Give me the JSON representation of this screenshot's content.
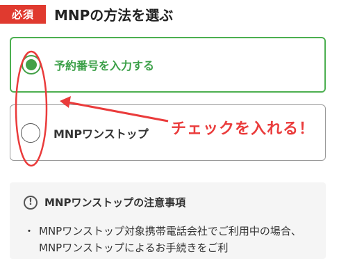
{
  "header": {
    "required_badge": "必須",
    "title": "MNPの方法を選ぶ"
  },
  "options": [
    {
      "label": "予約番号を入力する",
      "selected": true
    },
    {
      "label": "MNPワンストップ",
      "selected": false
    }
  ],
  "annotation": {
    "callout": "チェックを入れる！",
    "color": "#ea3b3b"
  },
  "notice": {
    "title": "MNPワンストップの注意事項",
    "bullet": "・",
    "text": "MNPワンストップ対象携帯電話会社でご利用中の場合、MNPワンストップによるお手続きをご利"
  },
  "colors": {
    "accent_green": "#43a047",
    "badge_red": "#e03a2f"
  }
}
